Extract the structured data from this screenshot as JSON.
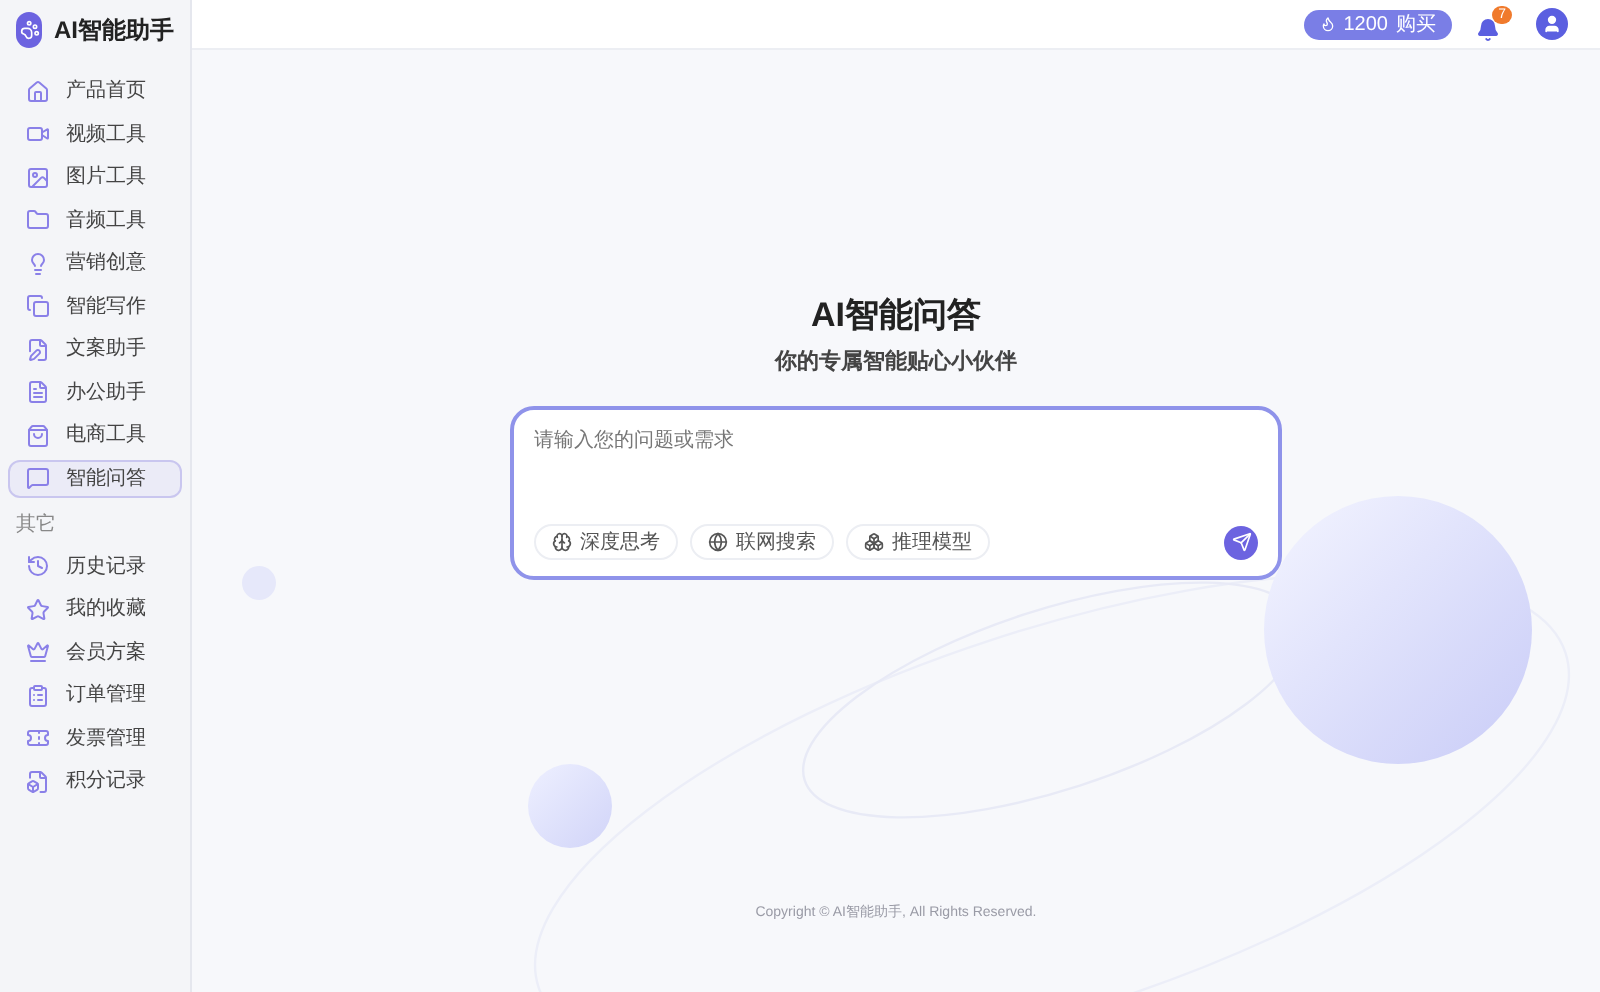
{
  "brand": {
    "title": "AI智能助手"
  },
  "sidebar": {
    "items": [
      {
        "label": "产品首页",
        "selected": false
      },
      {
        "label": "视频工具",
        "selected": false
      },
      {
        "label": "图片工具",
        "selected": false
      },
      {
        "label": "音频工具",
        "selected": false
      },
      {
        "label": "营销创意",
        "selected": false
      },
      {
        "label": "智能写作",
        "selected": false
      },
      {
        "label": "文案助手",
        "selected": false
      },
      {
        "label": "办公助手",
        "selected": false
      },
      {
        "label": "电商工具",
        "selected": false
      },
      {
        "label": "智能问答",
        "selected": true
      }
    ],
    "section": "其它",
    "other_items": [
      {
        "label": "历史记录",
        "selected": false
      },
      {
        "label": "我的收藏",
        "selected": false
      },
      {
        "label": "会员方案",
        "selected": false
      },
      {
        "label": "订单管理",
        "selected": false
      },
      {
        "label": "发票管理",
        "selected": false
      },
      {
        "label": "积分记录",
        "selected": false
      }
    ]
  },
  "header": {
    "points": "1200",
    "buy": "购买",
    "notification_count": "7"
  },
  "main": {
    "title": "AI智能问答",
    "subtitle": "你的专属智能贴心小伙伴",
    "input": {
      "placeholder": "请输入您的问题或需求"
    },
    "options": [
      {
        "label": "深度思考"
      },
      {
        "label": "联网搜索"
      },
      {
        "label": "推理模型"
      }
    ]
  },
  "footer": "Copyright © AI智能助手, All Rights Reserved."
}
